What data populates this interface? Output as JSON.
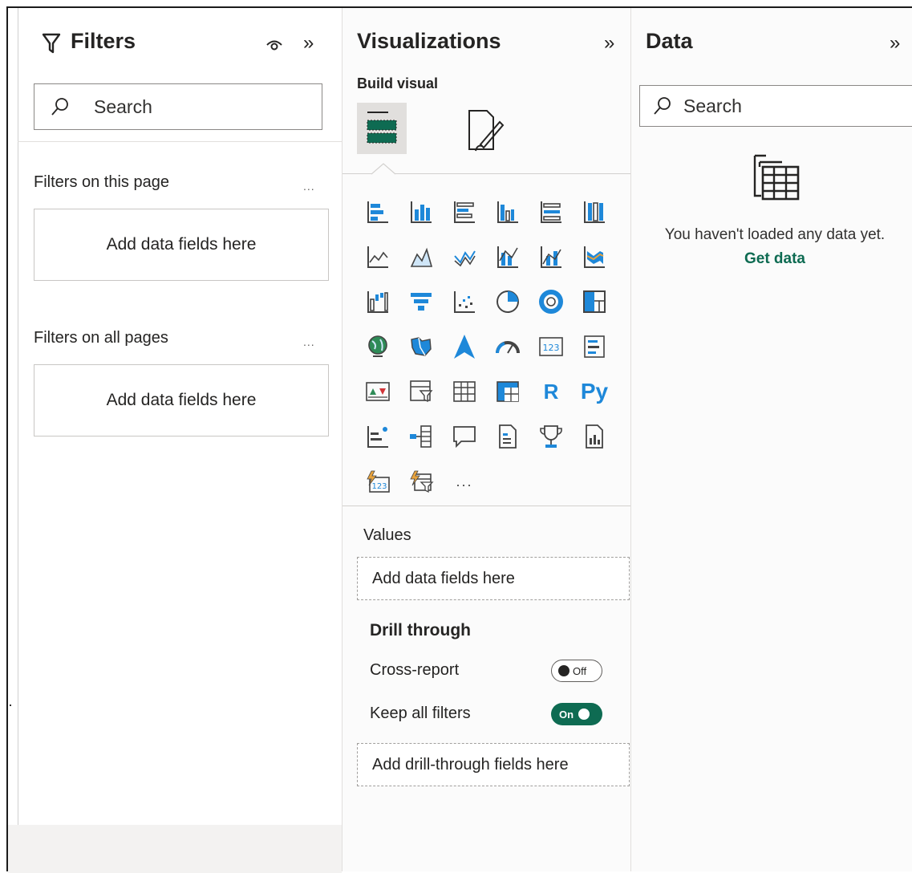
{
  "filters": {
    "title": "Filters",
    "search_placeholder": "Search",
    "this_page_label": "Filters on this page",
    "this_page_more": "...",
    "this_page_drop": "Add data fields here",
    "all_pages_label": "Filters on all pages",
    "all_pages_more": "...",
    "all_pages_drop": "Add data fields here"
  },
  "visualizations": {
    "title": "Visualizations",
    "build_visual_label": "Build visual",
    "icons": [
      "stacked-bar-chart-icon",
      "stacked-column-chart-icon",
      "clustered-bar-chart-icon",
      "clustered-column-chart-icon",
      "100-stacked-bar-chart-icon",
      "100-stacked-column-chart-icon",
      "line-chart-icon",
      "area-chart-icon",
      "stacked-area-chart-icon",
      "line-and-stacked-column-icon",
      "line-and-clustered-column-icon",
      "ribbon-chart-icon",
      "waterfall-chart-icon",
      "funnel-chart-icon",
      "scatter-chart-icon",
      "pie-chart-icon",
      "donut-chart-icon",
      "treemap-icon",
      "map-icon",
      "filled-map-icon",
      "azure-map-icon",
      "gauge-icon",
      "card-icon",
      "multi-row-card-icon",
      "kpi-icon",
      "slicer-icon",
      "table-icon",
      "matrix-icon",
      "r-script-visual-icon",
      "python-visual-icon",
      "key-influencers-icon",
      "decomposition-tree-icon",
      "qa-icon",
      "smart-narrative-icon",
      "metrics-icon",
      "paginated-report-icon",
      "power-apps-icon",
      "power-automate-icon",
      "more-visuals-icon"
    ],
    "r_label": "R",
    "py_label": "Py",
    "more_label": "...",
    "values_label": "Values",
    "values_drop": "Add data fields here",
    "drill_title": "Drill through",
    "cross_report_label": "Cross-report",
    "cross_report_state": "Off",
    "keep_filters_label": "Keep all filters",
    "keep_filters_state": "On",
    "drill_drop": "Add drill-through fields here",
    "accent_color": "#0e6b52",
    "icon_color": "#1e88d9"
  },
  "data": {
    "title": "Data",
    "search_placeholder": "Search",
    "empty_text": "You haven't loaded any data yet.",
    "get_data_link": "Get data",
    "link_color": "#0e6b52"
  }
}
